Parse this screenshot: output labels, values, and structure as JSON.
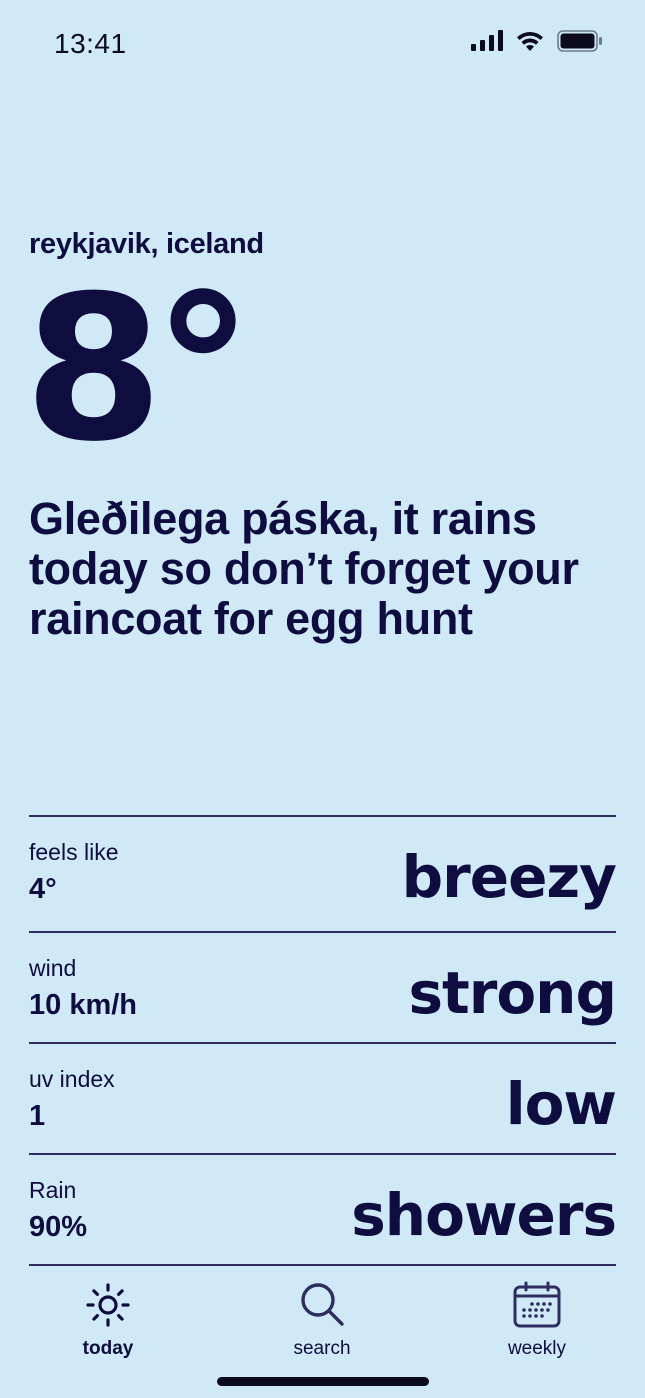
{
  "status_bar": {
    "time": "13:41",
    "icons": [
      "signal-icon",
      "wifi-icon",
      "battery-icon"
    ]
  },
  "location": "reykjavik, iceland",
  "temperature": "8°",
  "message": "Gleðilega páska, it rains today so don’t forget your raincoat for egg hunt",
  "metrics": [
    {
      "label": "feels like",
      "value": "4°",
      "description": "breezy"
    },
    {
      "label": "wind",
      "value": "10 km/h",
      "description": "strong"
    },
    {
      "label": "uv index",
      "value": "1",
      "description": "low"
    },
    {
      "label": "Rain",
      "value": "90%",
      "description": "showers"
    }
  ],
  "tabbar": {
    "tabs": [
      {
        "label": "today",
        "icon": "sun-icon",
        "active": true
      },
      {
        "label": "search",
        "icon": "search-icon",
        "active": false
      },
      {
        "label": "weekly",
        "icon": "calendar-icon",
        "active": false
      }
    ]
  },
  "colors": {
    "background": "#cfeaf6",
    "text": "#0f0c40",
    "divider": "#2e2c60"
  }
}
